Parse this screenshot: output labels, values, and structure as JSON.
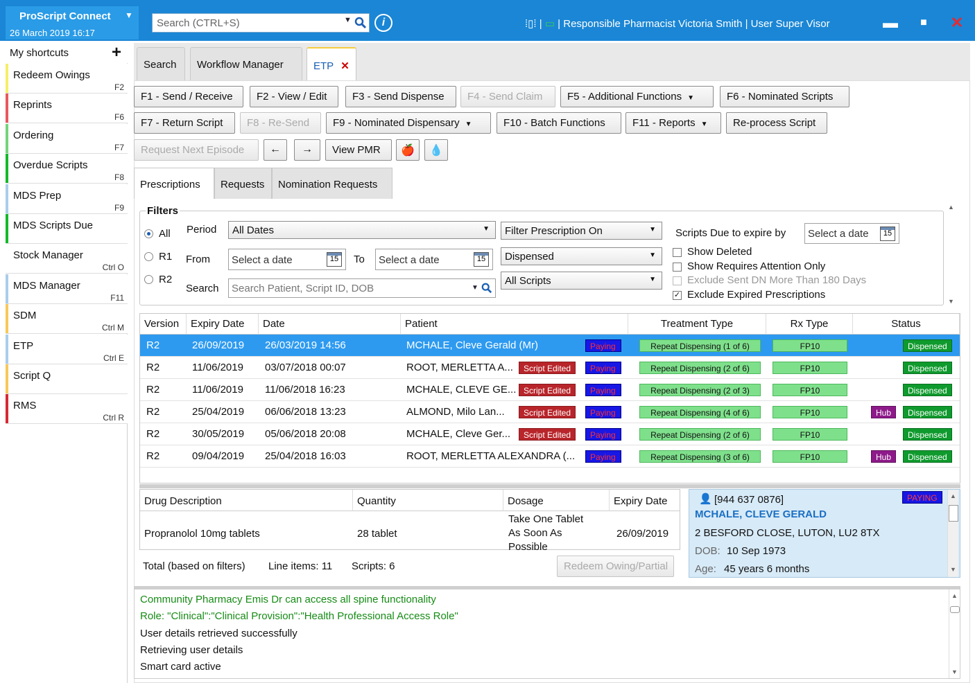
{
  "app": {
    "name": "ProScript Connect",
    "datetime": "26 March 2019 16:17",
    "search_placeholder": "Search (CTRL+S)",
    "status_text": "Responsible Pharmacist Victoria Smith | User Super Visor",
    "colors": {
      "titlebar": "#1a86d5",
      "accent_green": "#0f9a2d",
      "paying_blue": "#1717e6"
    }
  },
  "sidebar": {
    "header": "My shortcuts",
    "items": [
      {
        "label": "Redeem Owings",
        "key": "F2",
        "color": "#f5ef6a"
      },
      {
        "label": "Reprints",
        "key": "F6",
        "color": "#e8585e"
      },
      {
        "label": "Ordering",
        "key": "F7",
        "color": "#75d37c"
      },
      {
        "label": "Overdue Scripts",
        "key": "F8",
        "color": "#15b82c"
      },
      {
        "label": "MDS Prep",
        "key": "F9",
        "color": "#a9cdeb"
      },
      {
        "label": "MDS Scripts Due",
        "key": "",
        "color": "#15b82c"
      },
      {
        "label": "Stock Manager",
        "key": "Ctrl O",
        "color": "#ffffff"
      },
      {
        "label": "MDS Manager",
        "key": "F11",
        "color": "#a9cdeb"
      },
      {
        "label": "SDM",
        "key": "Ctrl M",
        "color": "#f7c85a"
      },
      {
        "label": "ETP",
        "key": "Ctrl E",
        "color": "#a9cdeb"
      },
      {
        "label": "Script Q",
        "key": "",
        "color": "#f7c85a"
      },
      {
        "label": "RMS",
        "key": "Ctrl R",
        "color": "#d62a34"
      }
    ]
  },
  "tabs": [
    "Search",
    "Workflow Manager",
    "ETP"
  ],
  "toolbar": {
    "row1": [
      "F1 - Send / Receive",
      "F2 - View / Edit",
      "F3 - Send Dispense",
      "F4 - Send Claim",
      "F5 - Additional Functions",
      "F6 - Nominated Scripts"
    ],
    "row2": [
      "F7 - Return Script",
      "F8 - Re-Send",
      "F9 - Nominated Dispensary",
      "F10 - Batch Functions",
      "F11 - Reports",
      "Re-process Script"
    ],
    "row3": [
      "Request Next Episode",
      "View PMR"
    ]
  },
  "subtabs": [
    "Prescriptions",
    "Requests",
    "Nomination Requests"
  ],
  "filters": {
    "title": "Filters",
    "radio_all": "All",
    "radio_r1": "R1",
    "radio_r2": "R2",
    "period_label": "Period",
    "period_value": "All Dates",
    "from_label": "From",
    "to_label": "To",
    "date_placeholder": "Select a date",
    "search_label": "Search",
    "search_placeholder": "Search Patient, Script ID, DOB",
    "filter_on": "Filter Prescription On",
    "dispensed": "Dispensed",
    "all_scripts": "All Scripts",
    "expire_label": "Scripts Due to expire by",
    "cal_day": "15",
    "checks": [
      {
        "label": "Show Deleted",
        "checked": false,
        "disabled": false
      },
      {
        "label": "Show Requires Attention Only",
        "checked": false,
        "disabled": false
      },
      {
        "label": "Exclude Sent DN More Than 180 Days",
        "checked": false,
        "disabled": true
      },
      {
        "label": "Exclude Expired Prescriptions",
        "checked": true,
        "disabled": false
      }
    ]
  },
  "grid": {
    "headers": [
      "Version",
      "Expiry Date",
      "Date",
      "Patient",
      "Treatment Type",
      "Rx Type",
      "Status"
    ],
    "paying": "Paying",
    "script_edited": "Script Edited",
    "hub": "Hub",
    "rows": [
      {
        "version": "R2",
        "expiry": "26/09/2019",
        "date": "26/03/2019 14:56",
        "patient": "MCHALE, Cleve Gerald (Mr)",
        "edited": false,
        "treatment": "Repeat Dispensing  (1 of 6)",
        "rx": "FP10",
        "hub": false,
        "status": "Dispensed"
      },
      {
        "version": "R2",
        "expiry": "11/06/2019",
        "date": "03/07/2018 00:07",
        "patient": "ROOT, MERLETTA A...",
        "edited": true,
        "treatment": "Repeat Dispensing  (2 of 6)",
        "rx": "FP10",
        "hub": false,
        "status": "Dispensed"
      },
      {
        "version": "R2",
        "expiry": "11/06/2019",
        "date": "11/06/2018 16:23",
        "patient": "MCHALE, CLEVE GE...",
        "edited": true,
        "treatment": "Repeat Dispensing  (2 of 3)",
        "rx": "FP10",
        "hub": false,
        "status": "Dispensed"
      },
      {
        "version": "R2",
        "expiry": "25/04/2019",
        "date": "06/06/2018 13:23",
        "patient": "ALMOND, Milo Lan...",
        "edited": true,
        "treatment": "Repeat Dispensing  (4 of 6)",
        "rx": "FP10",
        "hub": true,
        "status": "Dispensed"
      },
      {
        "version": "R2",
        "expiry": "30/05/2019",
        "date": "05/06/2018 20:08",
        "patient": "MCHALE, Cleve Ger...",
        "edited": true,
        "treatment": "Repeat Dispensing  (2 of 6)",
        "rx": "FP10",
        "hub": false,
        "status": "Dispensed"
      },
      {
        "version": "R2",
        "expiry": "09/04/2019",
        "date": "25/04/2018 16:03",
        "patient": "ROOT, MERLETTA ALEXANDRA (...",
        "edited": false,
        "treatment": "Repeat Dispensing  (3 of 6)",
        "rx": "FP10",
        "hub": true,
        "status": "Dispensed"
      }
    ]
  },
  "drug": {
    "headers": [
      "Drug Description",
      "Quantity",
      "Dosage",
      "Expiry Date"
    ],
    "row": {
      "description": "Propranolol 10mg tablets",
      "quantity": "28 tablet",
      "dosage_l1": "Take One Tablet",
      "dosage_l2": "As Soon As",
      "dosage_l3": "Possible",
      "expiry": "26/09/2019"
    }
  },
  "totals": {
    "label": "Total (based on filters)",
    "line_items": "Line items: 11",
    "scripts": "Scripts: 6",
    "redeem_button": "Redeem Owing/Partial"
  },
  "patient": {
    "nhs": "[944 637 0876]",
    "name": "MCHALE, CLEVE GERALD",
    "address": "2 BESFORD CLOSE, LUTON, LU2 8TX",
    "dob_label": "DOB:",
    "dob": "10 Sep 1973",
    "age_label": "Age:",
    "age": "45 years 6 months",
    "badge": "PAYING"
  },
  "log": [
    {
      "text": "Community Pharmacy Emis Dr can access all spine functionality",
      "color": "#168b16"
    },
    {
      "text": "Role: \"Clinical\":\"Clinical Provision\":\"Health Professional Access Role\"",
      "color": "#168b16"
    },
    {
      "text": "User details retrieved successfully",
      "color": "#111111"
    },
    {
      "text": "Retrieving user details",
      "color": "#111111"
    },
    {
      "text": "Smart card active",
      "color": "#111111"
    }
  ]
}
